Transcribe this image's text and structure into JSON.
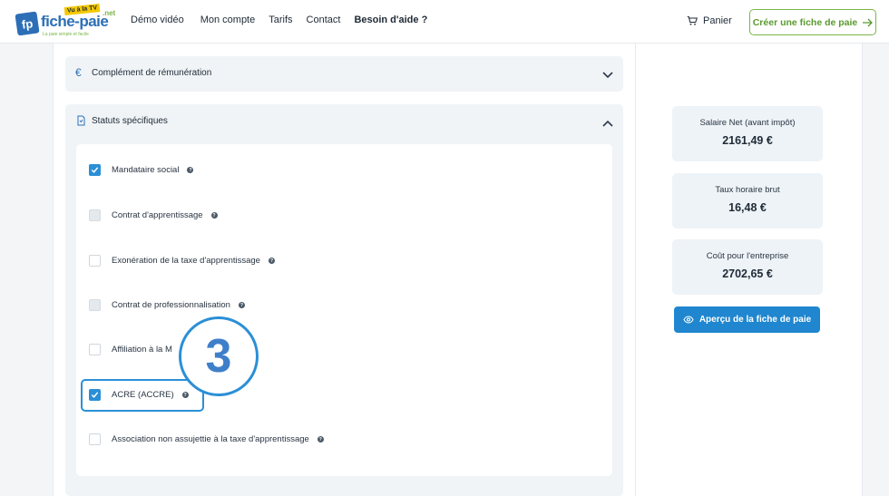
{
  "header": {
    "logo": {
      "mark": "fp",
      "name": "fiche-paie",
      "tv_badge": "Vu à la TV",
      "tld": ".net",
      "tagline": "La paie simple et facile"
    },
    "nav": [
      {
        "label": "Démo vidéo",
        "bold": false
      },
      {
        "label": "Mon compte",
        "bold": false
      },
      {
        "label": "Tarifs",
        "bold": false
      },
      {
        "label": "Contact",
        "bold": false
      },
      {
        "label": "Besoin d'aide ?",
        "bold": true
      }
    ],
    "cart_label": "Panier",
    "cta_label": "Créer une fiche de paie"
  },
  "sections": {
    "complement": {
      "label": "Complément de rémunération",
      "icon": "euro-icon",
      "expanded": false
    },
    "statuts": {
      "label": "Statuts spécifiques",
      "icon": "document-icon",
      "expanded": true
    }
  },
  "options": [
    {
      "label": "Mandataire social",
      "state": "checked"
    },
    {
      "label": "Contrat d'apprentissage",
      "state": "disabled"
    },
    {
      "label": "Exonération de la taxe d'apprentissage",
      "state": "unchecked"
    },
    {
      "label": "Contrat de professionnalisation",
      "state": "disabled"
    },
    {
      "label": "Affiliation à la M",
      "state": "unchecked"
    },
    {
      "label": "ACRE (ACCRE)",
      "state": "checked"
    },
    {
      "label": "Association non assujettie à la taxe d'apprentissage",
      "state": "unchecked"
    }
  ],
  "step_marker": "3",
  "summary": [
    {
      "label": "Salaire Net (avant impôt)",
      "value": "2161,49 €"
    },
    {
      "label": "Taux horaire brut",
      "value": "16,48 €"
    },
    {
      "label": "Coût pour l'entreprise",
      "value": "2702,65 €"
    }
  ],
  "preview_button": "Aperçu de la fiche de paie",
  "colors": {
    "accent": "#2b8fd6",
    "brand_blue": "#2c6fb7",
    "brand_green": "#7ab648",
    "button_blue": "#1f86cf"
  }
}
